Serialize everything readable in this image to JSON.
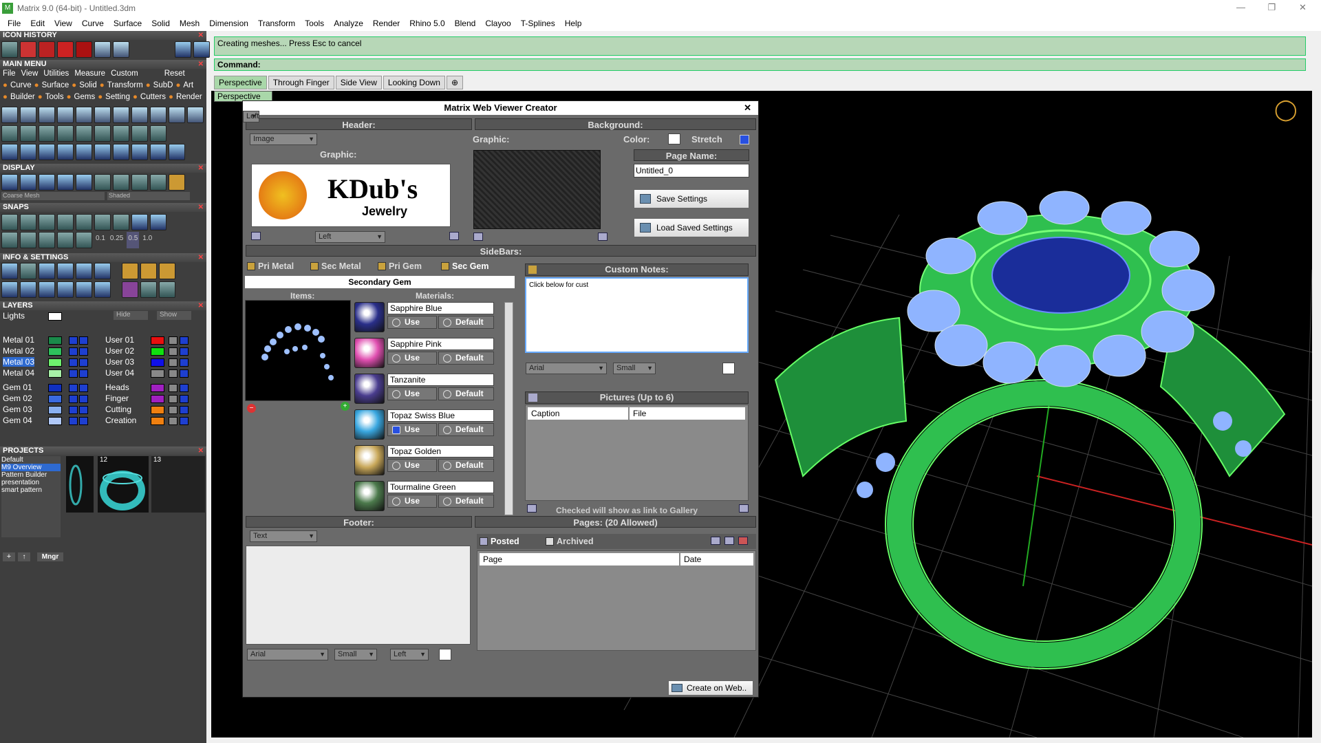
{
  "app": {
    "title": "Matrix 9.0 (64-bit) - Untitled.3dm",
    "minimize": "—",
    "restore": "❐",
    "close": "✕"
  },
  "menubar": [
    "File",
    "Edit",
    "View",
    "Curve",
    "Surface",
    "Solid",
    "Mesh",
    "Dimension",
    "Transform",
    "Tools",
    "Analyze",
    "Render",
    "Rhino 5.0",
    "Blend",
    "Clayoo",
    "T-Splines",
    "Help"
  ],
  "left": {
    "icon_history": "ICON HISTORY",
    "main_menu": "MAIN MENU",
    "main_menu_row": [
      "File",
      "View",
      "Utilities",
      "Measure",
      "Custom",
      "Reset"
    ],
    "main_row2": [
      "Curve",
      "Surface",
      "Solid",
      "Transform",
      "SubD",
      "Art"
    ],
    "main_row3": [
      "Builder",
      "Tools",
      "Gems",
      "Setting",
      "Cutters",
      "Render"
    ],
    "display": "DISPLAY",
    "display_mesh": "Coarse Mesh",
    "display_mode": "Shaded",
    "snaps": "SNAPS",
    "snap_values": [
      "0.1",
      "0.25",
      "0.5",
      "1.0"
    ],
    "info_settings": "INFO & SETTINGS",
    "layers": "LAYERS",
    "layers_lights": "Lights",
    "hide": "Hide",
    "show": "Show",
    "layer_left": [
      "Metal 01",
      "Metal 02",
      "Metal 03",
      "Metal 04",
      "Gem 01",
      "Gem 02",
      "Gem 03",
      "Gem 04"
    ],
    "layer_right": [
      "User 01",
      "User 02",
      "User 03",
      "User 04",
      "Heads",
      "Finger",
      "Cutting",
      "Creation"
    ],
    "projects": "PROJECTS",
    "project_list": [
      "Default",
      "M9 Overview",
      "Pattern Builder",
      "presentation",
      "smart pattern"
    ],
    "project_nums": [
      "12",
      "13"
    ],
    "mngr": "Mngr"
  },
  "viewport": {
    "status": "Creating meshes... Press Esc to cancel",
    "command": "Command:",
    "tabs": [
      "Perspective",
      "Through Finger",
      "Side View",
      "Looking Down"
    ],
    "add_tab": "⊕",
    "label": "Perspective"
  },
  "dialog": {
    "title": "Matrix Web Viewer Creator",
    "close": "✕",
    "header": "Header:",
    "header_type": "Image",
    "graphic": "Graphic:",
    "logo_main": "KDub's",
    "logo_sub": "Jewelry",
    "align_left": "Left",
    "background": "Background:",
    "bg_graphic": "Graphic:",
    "color": "Color:",
    "stretch": "Stretch",
    "page_name_label": "Page Name:",
    "page_name": "Untitled_0",
    "save_settings": "Save Settings",
    "load_settings": "Load Saved Settings",
    "sidebars": "SideBars:",
    "sidebar_tabs": [
      "Pri Metal",
      "Sec Metal",
      "Pri Gem",
      "Sec Gem"
    ],
    "secondary_gem": "Secondary Gem",
    "items": "Items:",
    "materials_label": "Materials:",
    "materials": [
      {
        "name": "Sapphire Blue",
        "use": "Use",
        "default": "Default",
        "color": "#2a2f8a",
        "use_on": false
      },
      {
        "name": "Sapphire Pink",
        "use": "Use",
        "default": "Default",
        "color": "#e04fb0",
        "use_on": false
      },
      {
        "name": "Tanzanite",
        "use": "Use",
        "default": "Default",
        "color": "#4a3d8f",
        "use_on": false
      },
      {
        "name": "Topaz Swiss Blue",
        "use": "Use",
        "default": "Default",
        "color": "#39a7e0",
        "use_on": true
      },
      {
        "name": "Topaz Golden",
        "use": "Use",
        "default": "Default",
        "color": "#c9a85a",
        "use_on": false
      },
      {
        "name": "Tourmaline Green",
        "use": "Use",
        "default": "Default",
        "color": "#4c7a4c",
        "use_on": false
      }
    ],
    "custom_notes": "Custom Notes:",
    "notes_text": "Click below for cust",
    "font": "Arial",
    "size": "Small",
    "align": "Left",
    "pictures": "Pictures (Up to 6)",
    "pic_cols": [
      "Caption",
      "File"
    ],
    "gallery_note": "Checked will show as link to Gallery",
    "footer": "Footer:",
    "footer_type": "Text",
    "pages": "Pages: (20 Allowed)",
    "posted": "Posted",
    "archived": "Archived",
    "page_cols": [
      "Page",
      "Date"
    ],
    "create": "Create on Web.."
  },
  "colors": {
    "accent": "#a9d7a9",
    "wire": "#2fbf4f",
    "gem": "#8fb4ff"
  }
}
